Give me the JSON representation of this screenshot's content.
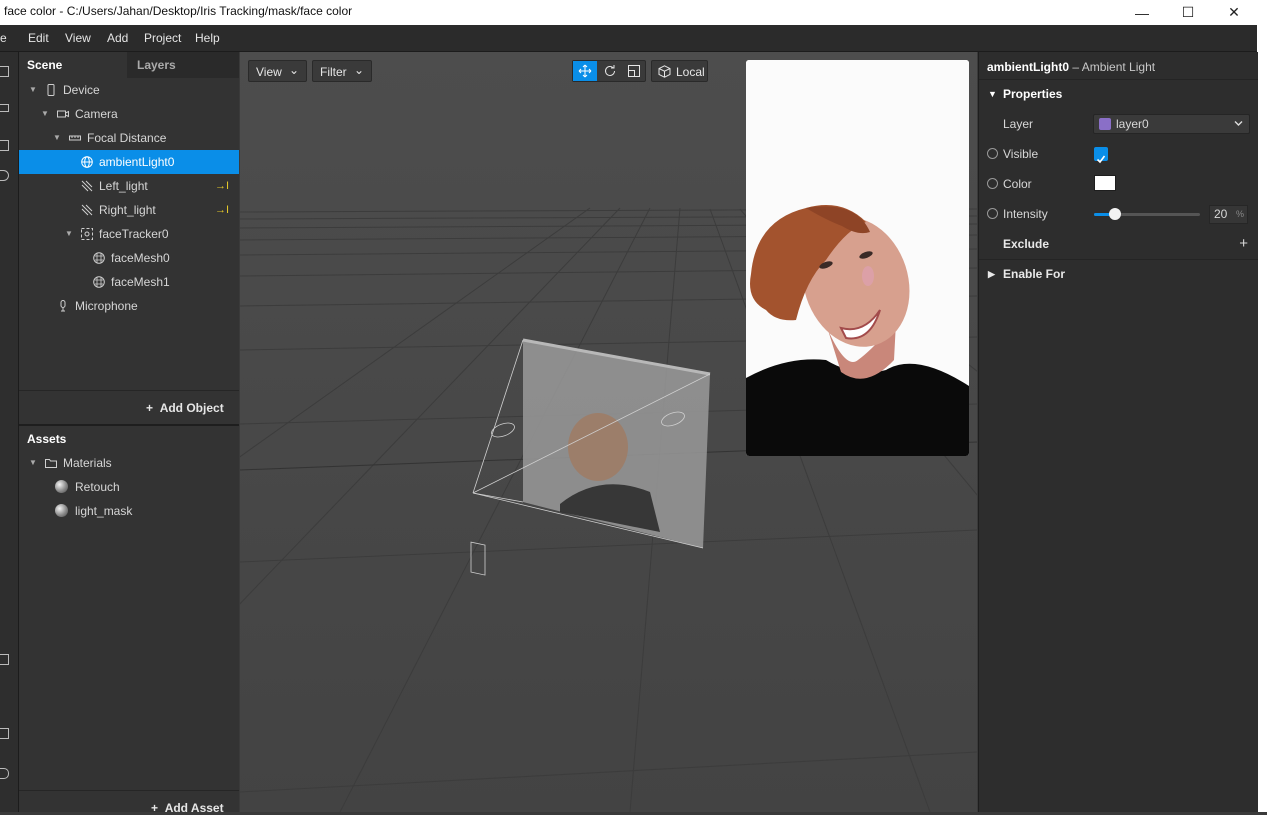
{
  "window": {
    "title": "face color - C:/Users/Jahan/Desktop/Iris Tracking/mask/face color",
    "min_icon": "—",
    "max_icon": "☐",
    "close_icon": "✕"
  },
  "menu": {
    "items": [
      "e",
      "Edit",
      "View",
      "Add",
      "Project",
      "Help"
    ]
  },
  "scene_panel": {
    "tabs": [
      "Scene",
      "Layers"
    ],
    "tree": [
      {
        "label": "Device",
        "icon": "device-icon",
        "level": 0,
        "expanded": true
      },
      {
        "label": "Camera",
        "icon": "camera-icon",
        "level": 1,
        "expanded": true
      },
      {
        "label": "Focal Distance",
        "icon": "ruler-icon",
        "level": 2,
        "expanded": true
      },
      {
        "label": "ambientLight0",
        "icon": "globe-icon",
        "level": 3,
        "selected": true
      },
      {
        "label": "Left_light",
        "icon": "directional-light-icon",
        "level": 3,
        "badge": "→I"
      },
      {
        "label": "Right_light",
        "icon": "directional-light-icon",
        "level": 3,
        "badge": "→I"
      },
      {
        "label": "faceTracker0",
        "icon": "face-tracker-icon",
        "level": 2,
        "expanded": true
      },
      {
        "label": "faceMesh0",
        "icon": "mesh-icon",
        "level": 3
      },
      {
        "label": "faceMesh1",
        "icon": "mesh-icon",
        "level": 3
      },
      {
        "label": "Microphone",
        "icon": "microphone-icon",
        "level": 1
      }
    ],
    "add_object": "Add Object",
    "plus": "+"
  },
  "assets": {
    "title": "Assets",
    "folder": "Materials",
    "items": [
      "Retouch",
      "light_mask"
    ],
    "add_asset": "Add Asset",
    "plus": "+"
  },
  "viewport": {
    "view_button": "View",
    "filter_button": "Filter",
    "local_button": "Local",
    "chevron": "⌄"
  },
  "properties": {
    "header_name": "ambientLight0",
    "header_type": " – Ambient Light",
    "section": "Properties",
    "layer_label": "Layer",
    "layer_value": "layer0",
    "layer_color": "#8a6fc7",
    "visible_label": "Visible",
    "visible_checked": true,
    "color_label": "Color",
    "color_value": "#ffffff",
    "intensity_label": "Intensity",
    "intensity_value": "20",
    "intensity_unit": "%",
    "intensity_fraction": 0.2,
    "exclude_label": "Exclude",
    "exclude_plus": "+",
    "enable_for_label": "Enable For"
  }
}
